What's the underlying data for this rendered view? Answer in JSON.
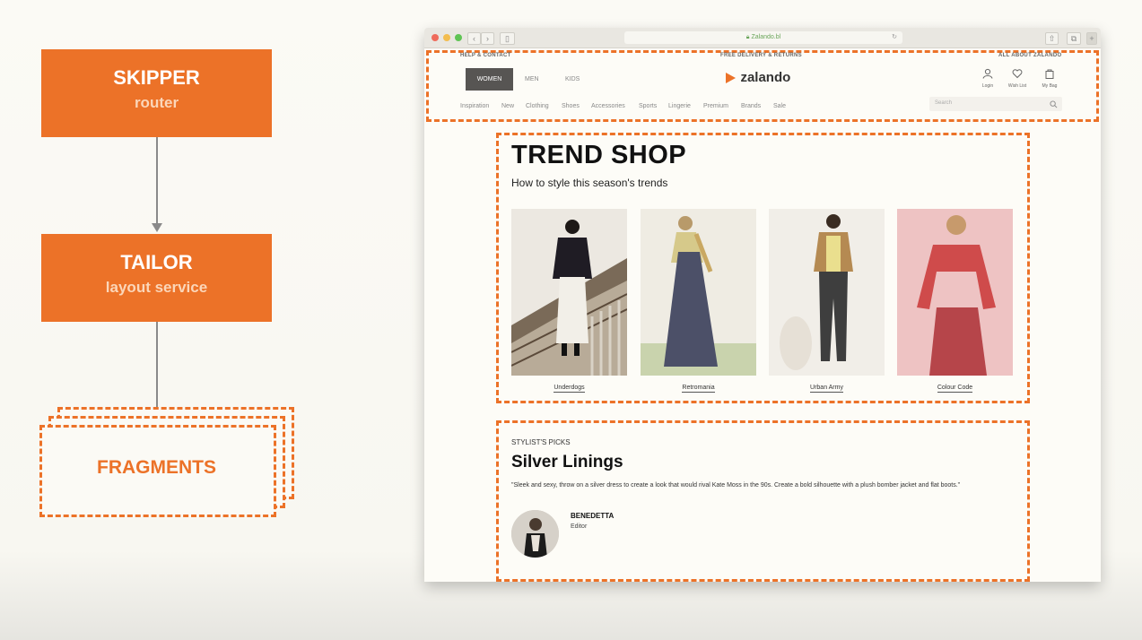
{
  "diagram": {
    "skipper": {
      "title": "SKIPPER",
      "subtitle": "router"
    },
    "tailor": {
      "title": "TAILOR",
      "subtitle": "layout service"
    },
    "fragments": {
      "label": "FRAGMENTS"
    }
  },
  "browser": {
    "url": "Zalando.bl",
    "top_bar": {
      "left": "HELP & CONTACT",
      "center": "FREE DELIVERY & RETURNS",
      "right": "ALL ABOUT ZALANDO"
    },
    "gender_tabs": [
      "WOMEN",
      "MEN",
      "KIDS"
    ],
    "logo": "zalando",
    "account": {
      "login": "Login",
      "wishlist": "Wish List",
      "bag": "My Bag"
    },
    "categories": [
      "Inspiration",
      "New",
      "Clothing",
      "Shoes",
      "Accessories",
      "Sports",
      "Lingerie",
      "Premium",
      "Brands",
      "Sale"
    ],
    "search_placeholder": "Search",
    "trend": {
      "title": "TREND SHOP",
      "subtitle": "How to style this season's trends",
      "items": [
        {
          "label": "Underdogs"
        },
        {
          "label": "Retromania"
        },
        {
          "label": "Urban Army"
        },
        {
          "label": "Colour Code"
        }
      ]
    },
    "stylist": {
      "kicker": "STYLIST'S PICKS",
      "title": "Silver Linings",
      "quote": "\"Sleek and sexy, throw on a silver dress to create a look that would rival Kate Moss in the 90s. Create a bold silhouette with a plush bomber jacket and flat boots.\"",
      "name": "BENEDETTA",
      "role": "Editor"
    }
  },
  "colors": {
    "accent": "#ec7228"
  }
}
